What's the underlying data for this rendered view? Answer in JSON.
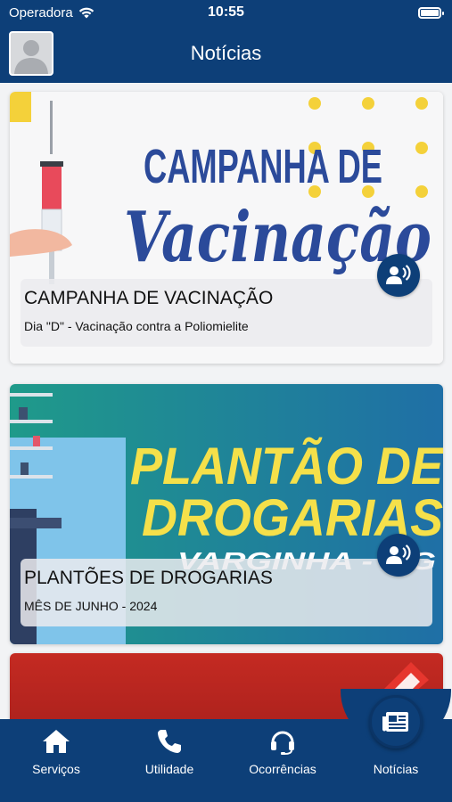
{
  "status_bar": {
    "carrier": "Operadora",
    "time": "10:55"
  },
  "header": {
    "title": "Notícias"
  },
  "news": [
    {
      "banner_line1": "CAMPANHA DE",
      "banner_line2": "Vacinação",
      "title": "CAMPANHA DE VACINAÇÃO",
      "subtitle": "Dia \"D\" - Vacinação contra a Poliomielite"
    },
    {
      "banner_line1": "PLANTÃO DE",
      "banner_line2": "DROGARIAS",
      "banner_line3": "VARGINHA - MG",
      "title": "PLANTÕES DE DROGARIAS",
      "subtitle": "MÊS DE JUNHO - 2024"
    }
  ],
  "tabs": [
    {
      "label": "Serviços",
      "icon": "home-icon"
    },
    {
      "label": "Utilidade",
      "icon": "phone-icon"
    },
    {
      "label": "Ocorrências",
      "icon": "headset-icon"
    },
    {
      "label": "Notícias",
      "icon": "newspaper-icon"
    }
  ],
  "colors": {
    "primary": "#0d3f78",
    "accent_yellow": "#f4d13a",
    "banner_blue": "#2b4a9a"
  }
}
